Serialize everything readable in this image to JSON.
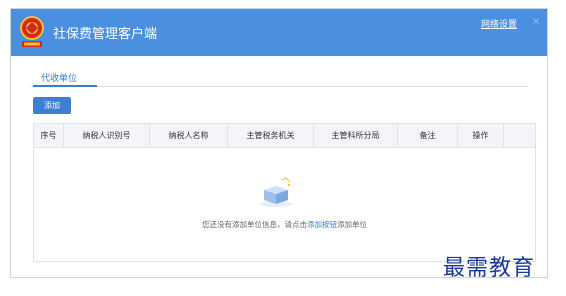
{
  "app": {
    "title": "社保费管理客户端",
    "network_settings": "网络设置",
    "close": "×"
  },
  "tabs": [
    {
      "label": "代收单位"
    }
  ],
  "toolbar": {
    "add_label": "添加"
  },
  "table": {
    "columns": [
      "序号",
      "纳税人识别号",
      "纳税人名称",
      "主管税务机关",
      "主管科所分局",
      "备注",
      "操作"
    ]
  },
  "empty": {
    "prefix": "您还没有添加单位信息，请点击",
    "link": "添加按钮",
    "suffix": "添加单位"
  },
  "watermark": "最需教育",
  "colors": {
    "titlebar": "#4a8fe0",
    "accent": "#3a7bd5"
  }
}
